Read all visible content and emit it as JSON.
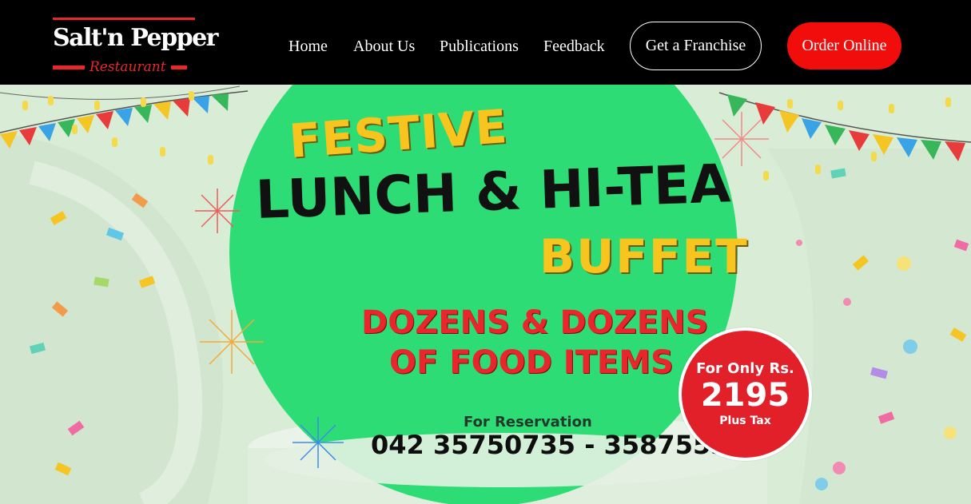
{
  "header": {
    "logo": {
      "brand": "Salt'n Pepper",
      "subtitle": "Restaurant"
    },
    "nav": [
      {
        "label": "Home"
      },
      {
        "label": "About Us"
      },
      {
        "label": "Publications"
      },
      {
        "label": "Feedback"
      }
    ],
    "franchise_button": "Get a Franchise",
    "order_button": "Order Online",
    "colors": {
      "background": "#000000",
      "accent": "#f20d0d",
      "text": "#ffffff"
    }
  },
  "banner": {
    "headline_1": "FESTIVE",
    "headline_2": "LUNCH & HI-TEA",
    "headline_3": "BUFFET",
    "tagline_1": "DOZENS & DOZENS",
    "tagline_2": "OF FOOD ITEMS",
    "reservation_label": "For Reservation",
    "phones": "042 35750735 - 35875536",
    "price": {
      "prefix": "For Only Rs.",
      "amount": "2195",
      "suffix": "Plus Tax"
    },
    "colors": {
      "circle": "#2edc75",
      "yellow": "#f7c51e",
      "red": "#e8262b",
      "background": "#d9ecd6"
    }
  }
}
